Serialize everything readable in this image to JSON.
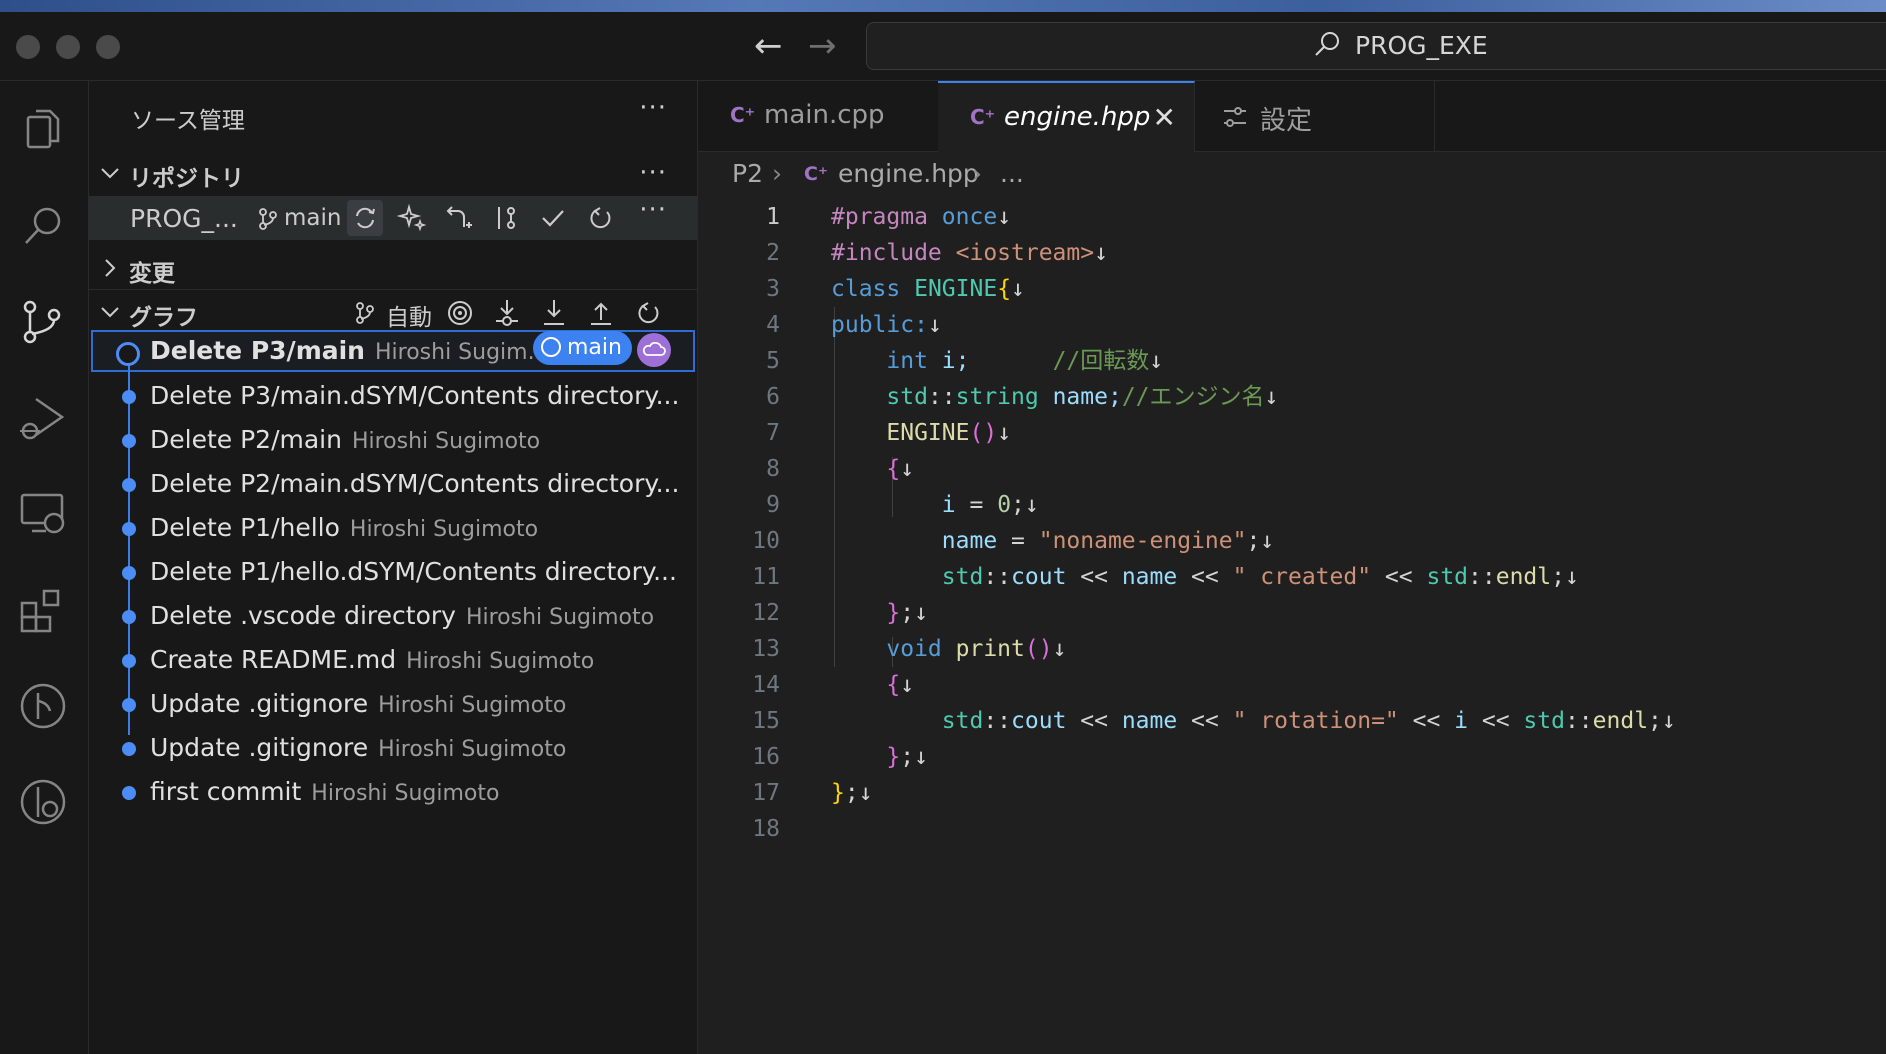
{
  "window": {
    "search_label": "PROG_EXE"
  },
  "sidebar": {
    "title": "ソース管理",
    "more": "···",
    "repos_section": "リポジトリ",
    "repo": {
      "name": "PROG_...",
      "branch": "main"
    },
    "changes_section": "変更",
    "graph_section": "グラフ",
    "graph_auto": "自動",
    "commits": [
      {
        "message": "Delete P3/main",
        "author": "Hiroshi Sugim...",
        "badge": "main"
      },
      {
        "message": "Delete P3/main.dSYM/Contents directory...",
        "author": ""
      },
      {
        "message": "Delete P2/main",
        "author": "Hiroshi Sugimoto"
      },
      {
        "message": "Delete P2/main.dSYM/Contents directory...",
        "author": ""
      },
      {
        "message": "Delete P1/hello",
        "author": "Hiroshi Sugimoto"
      },
      {
        "message": "Delete P1/hello.dSYM/Contents directory...",
        "author": ""
      },
      {
        "message": "Delete .vscode directory",
        "author": "Hiroshi Sugimoto"
      },
      {
        "message": "Create README.md",
        "author": "Hiroshi Sugimoto"
      },
      {
        "message": "Update .gitignore",
        "author": "Hiroshi Sugimoto"
      },
      {
        "message": "Update .gitignore",
        "author": "Hiroshi Sugimoto"
      },
      {
        "message": "first commit",
        "author": "Hiroshi Sugimoto"
      }
    ]
  },
  "editor": {
    "tabs": [
      {
        "label": "main.cpp",
        "icon": "C⁺"
      },
      {
        "label": "engine.hpp",
        "icon": "C⁺",
        "close": "✕"
      },
      {
        "label": "設定"
      }
    ],
    "breadcrumb": {
      "folder": "P2",
      "file": "engine.hpp",
      "more": "..."
    },
    "line_numbers": [
      "1",
      "2",
      "3",
      "4",
      "5",
      "6",
      "7",
      "8",
      "9",
      "10",
      "11",
      "12",
      "13",
      "14",
      "15",
      "16",
      "17",
      "18"
    ],
    "code": {
      "l1": [
        "#pragma",
        " once",
        "↓"
      ],
      "l2": [
        "#include",
        " <iostream>",
        "↓"
      ],
      "l3": [
        "class",
        " ENGINE",
        "{",
        "↓"
      ],
      "l4": [
        "public:",
        "↓"
      ],
      "l5": [
        "int",
        " i;      ",
        "//回転数",
        "↓"
      ],
      "l6": [
        "std",
        "::",
        "string",
        " name;",
        "//エンジン名",
        "↓"
      ],
      "l7": [
        "ENGINE",
        "()",
        "↓"
      ],
      "l8": [
        "{",
        "↓"
      ],
      "l9": [
        "i",
        " = ",
        "0",
        ";",
        "↓"
      ],
      "l10": [
        "name",
        " = ",
        "\"noname-engine\"",
        ";",
        "↓"
      ],
      "l11": [
        "std",
        "::",
        "cout",
        " << ",
        "name",
        " << ",
        "\" created\"",
        " << ",
        "std",
        "::",
        "endl",
        ";",
        "↓"
      ],
      "l12": [
        "}",
        ";",
        "↓"
      ],
      "l13": [
        "void",
        " print",
        "()",
        "↓"
      ],
      "l14": [
        "{",
        "↓"
      ],
      "l15": [
        "std",
        "::",
        "cout",
        " << ",
        "name",
        " << ",
        "\" rotation=\"",
        " << ",
        "i",
        " << ",
        "std",
        "::",
        "endl",
        ";",
        "↓"
      ],
      "l16": [
        "}",
        ";",
        "↓"
      ],
      "l17": [
        "}",
        ";",
        "↓"
      ]
    }
  }
}
